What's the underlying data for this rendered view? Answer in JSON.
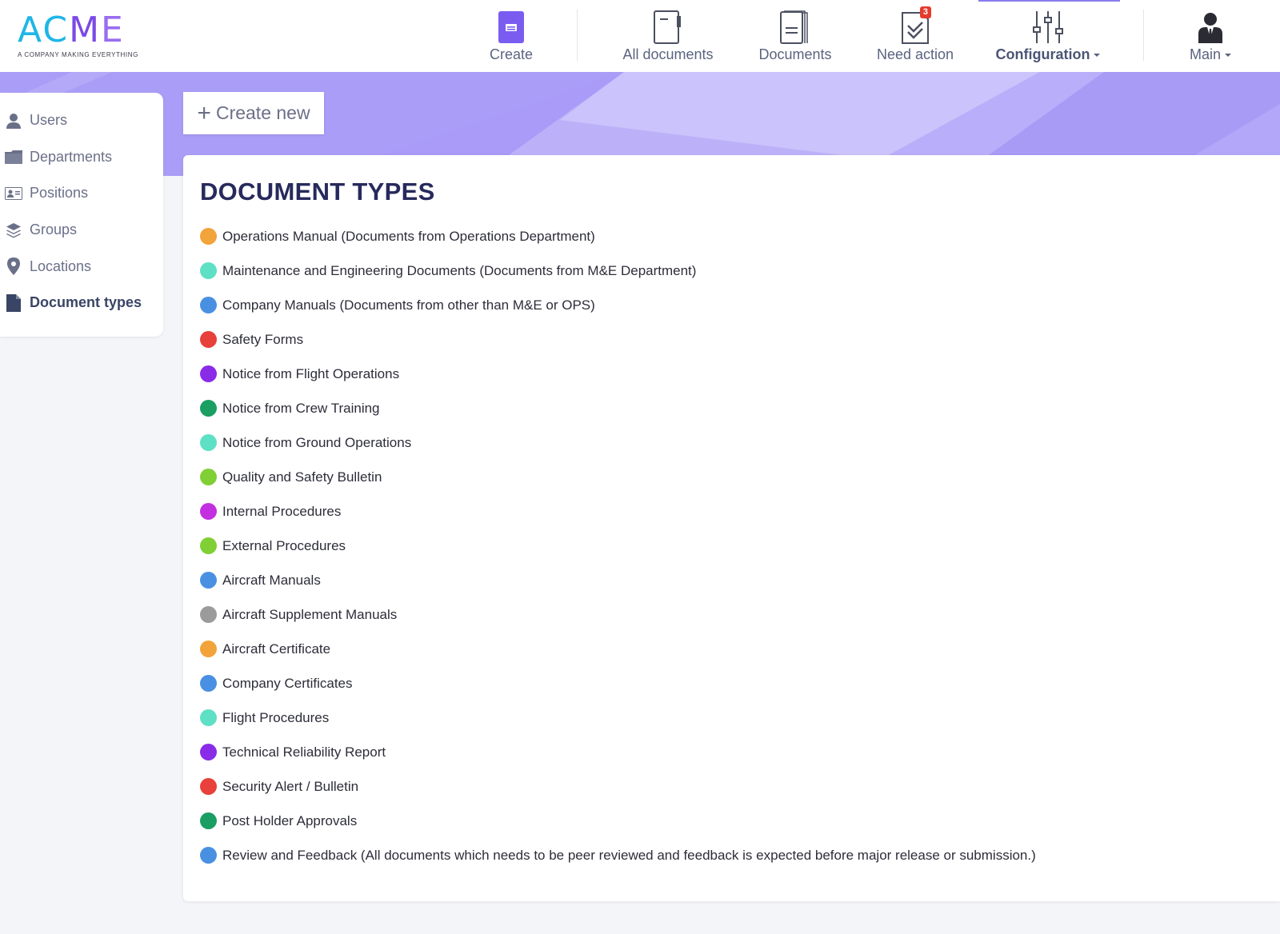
{
  "brand": {
    "logo_text": "ACME",
    "tagline": "A COMPANY MAKING EVERYTHING"
  },
  "nav": {
    "create": "Create",
    "all_documents": "All documents",
    "documents": "Documents",
    "need_action": "Need action",
    "need_action_badge": "3",
    "configuration": "Configuration",
    "main": "Main"
  },
  "sidebar": {
    "items": [
      {
        "label": "Users",
        "icon": "user-icon"
      },
      {
        "label": "Departments",
        "icon": "folder-icon"
      },
      {
        "label": "Positions",
        "icon": "id-card-icon"
      },
      {
        "label": "Groups",
        "icon": "layers-icon"
      },
      {
        "label": "Locations",
        "icon": "location-pin-icon"
      },
      {
        "label": "Document types",
        "icon": "document-icon",
        "active": true
      }
    ]
  },
  "create_new_label": "Create new",
  "page_title": "DOCUMENT TYPES",
  "document_types": [
    {
      "label": "Operations Manual (Documents from Operations Department)",
      "color": "#f2a33a"
    },
    {
      "label": "Maintenance and Engineering Documents (Documents from M&E Department)",
      "color": "#5ee0c4"
    },
    {
      "label": "Company Manuals (Documents from other than M&E or OPS)",
      "color": "#4a90e2"
    },
    {
      "label": "Safety Forms",
      "color": "#e8403a"
    },
    {
      "label": "Notice from Flight Operations",
      "color": "#8a2be8"
    },
    {
      "label": "Notice from Crew Training",
      "color": "#1a9e62"
    },
    {
      "label": "Notice from Ground Operations",
      "color": "#5ee0c4"
    },
    {
      "label": "Quality and Safety Bulletin",
      "color": "#7fcf35"
    },
    {
      "label": "Internal Procedures",
      "color": "#c230e0"
    },
    {
      "label": "External Procedures",
      "color": "#7fcf35"
    },
    {
      "label": "Aircraft Manuals",
      "color": "#4a90e2"
    },
    {
      "label": "Aircraft Supplement Manuals",
      "color": "#9b9b9b"
    },
    {
      "label": "Aircraft Certificate",
      "color": "#f2a33a"
    },
    {
      "label": "Company Certificates",
      "color": "#4a90e2"
    },
    {
      "label": "Flight Procedures",
      "color": "#5ee0c4"
    },
    {
      "label": "Technical Reliability Report",
      "color": "#8a2be8"
    },
    {
      "label": "Security Alert / Bulletin",
      "color": "#e8403a"
    },
    {
      "label": "Post Holder Approvals",
      "color": "#1a9e62"
    },
    {
      "label": "Review and Feedback (All documents which needs to be peer reviewed and feedback is expected before major release or submission.)",
      "color": "#4a90e2"
    }
  ]
}
